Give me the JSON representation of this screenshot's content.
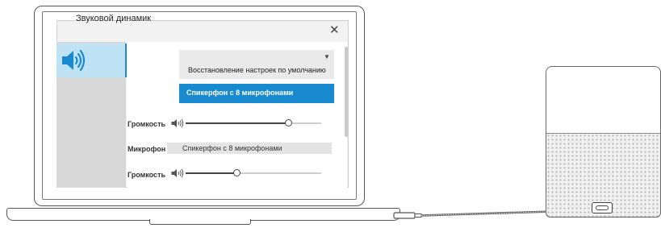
{
  "dialog": {
    "title": "Звуковой динамик",
    "close_glyph": "✕"
  },
  "sidebar": {
    "items": [
      {
        "icon": "speaker-icon",
        "selected": true
      }
    ]
  },
  "playback": {
    "device_dropdown": {
      "value": "Восстановление настроек по умолчанию",
      "arrow_glyph": "▼",
      "highlighted_option": "Спикерфон с 8 микрофонами"
    },
    "volume_label": "Громкость",
    "volume_level_percent": 76
  },
  "recording": {
    "microphone_label": "Микрофон",
    "microphone_value": "Спикерфон с 8 микрофонами",
    "volume_label": "Громкость",
    "volume_level_percent": 38
  },
  "colors": {
    "accent": "#1a8ad0",
    "selected_bg": "#bfe2f5",
    "sidebar_bg": "#d8d8d8"
  }
}
